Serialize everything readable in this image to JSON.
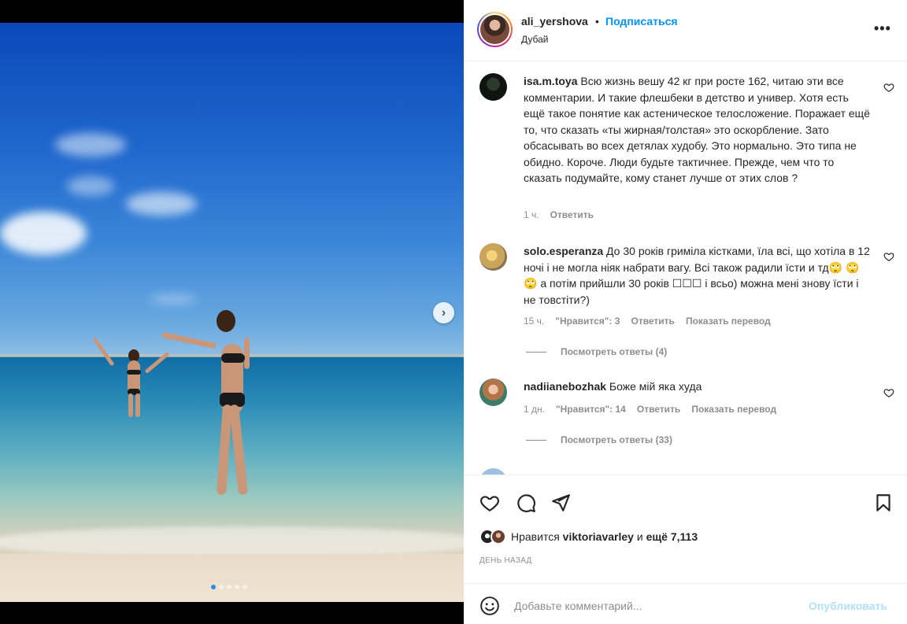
{
  "post": {
    "username": "ali_yershova",
    "separator": "•",
    "follow_label": "Подписаться",
    "location": "Дубай",
    "more_label": "•••"
  },
  "media": {
    "next_label": "›",
    "dots_total": 5,
    "dots_active": 1
  },
  "comments": [
    {
      "username": "isa.m.toya",
      "text": "Всю жизнь вешу 42 кг при росте 162, читаю эти все комментарии. И такие флешбеки в детство и универ. Хотя есть ещё такое понятие как астеническое телосложение. Поражает ещё то, что сказать «ты жирная/толстая» это оскорбление. Зато обсасывать во всех детялах худобу. Это нормально. Это типа не обидно. Короче. Люди будьте тактичнее. Прежде, чем что то сказать подумайте, кому станет лучше от этих слов ?",
      "time": "1 ч.",
      "reply_label": "Ответить"
    },
    {
      "username": "solo.esperanza",
      "text": "До 30 років гриміла кістками, їла всі, що хотіла в 12 ночі і не могла ніяк набрати вагу. Всі також радили їсти и тд🙄 🙄 🙄 а потім прийшли 30 років ☐☐☐ і всьо) можна мені знову їсти і не товстіти?)",
      "time": "15 ч.",
      "likes_label": "\"Нравится\": 3",
      "reply_label": "Ответить",
      "translate_label": "Показать перевод",
      "view_replies": "Посмотреть ответы (4)"
    },
    {
      "username": "nadiianebozhak",
      "text": "Боже мій яка худа",
      "time": "1 дн.",
      "likes_label": "\"Нравится\": 14",
      "reply_label": "Ответить",
      "translate_label": "Показать перевод",
      "view_replies": "Посмотреть ответы (33)"
    }
  ],
  "likes": {
    "prefix": "Нравится",
    "user": "viktoriavarley",
    "middle": "и",
    "rest": "ещё 7,113"
  },
  "time_ago": "ДЕНЬ НАЗАД",
  "add_comment": {
    "placeholder": "Добавьте комментарий...",
    "publish_label": "Опубликовать"
  }
}
